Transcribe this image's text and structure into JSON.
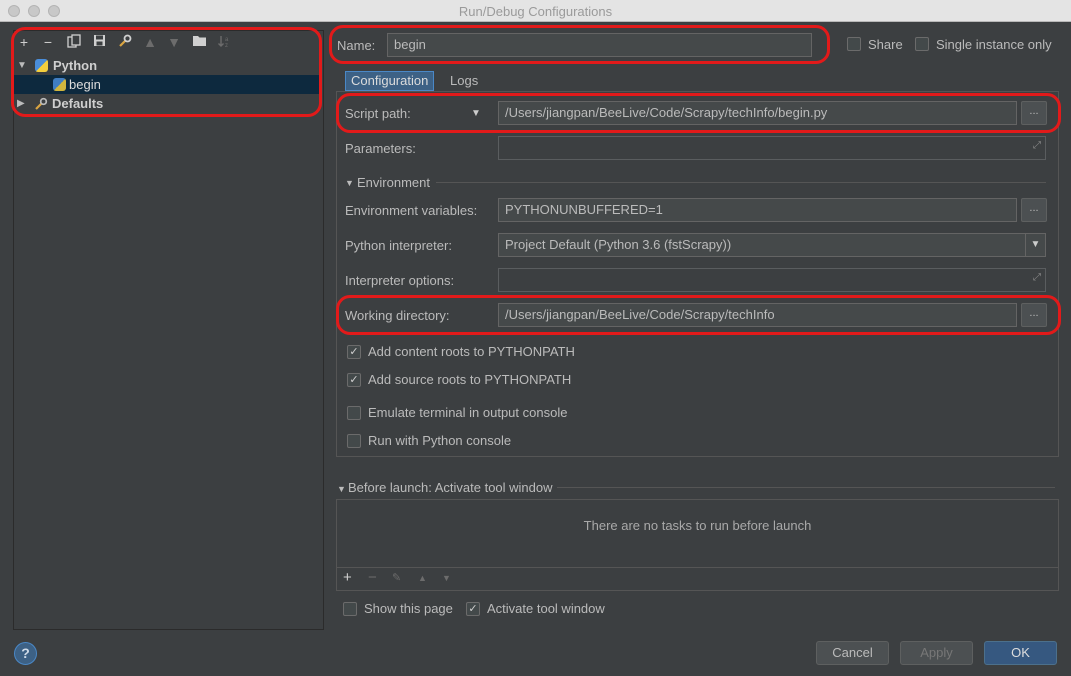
{
  "window": {
    "title": "Run/Debug Configurations"
  },
  "toolbar": {
    "icons": [
      "plus-icon",
      "minus-icon",
      "copy-icon",
      "save-icon",
      "wrench-icon",
      "arrow-up-icon",
      "arrow-down-icon",
      "folder-icon",
      "sort-icon"
    ]
  },
  "tree": {
    "python_label": "Python",
    "begin_label": "begin",
    "defaults_label": "Defaults"
  },
  "header": {
    "name_label": "Name:",
    "name_value": "begin",
    "share_label": "Share",
    "single_instance_label": "Single instance only"
  },
  "tabs": {
    "configuration": "Configuration",
    "logs": "Logs"
  },
  "config": {
    "script_path_label": "Script path:",
    "script_path_value": "/Users/jiangpan/BeeLive/Code/Scrapy/techInfo/begin.py",
    "parameters_label": "Parameters:",
    "environment_section": "Environment",
    "env_vars_label": "Environment variables:",
    "env_vars_value": "PYTHONUNBUFFERED=1",
    "interpreter_label": "Python interpreter:",
    "interpreter_value": "Project Default (Python 3.6 (fstScrapy))",
    "interpreter_options_label": "Interpreter options:",
    "working_dir_label": "Working directory:",
    "working_dir_value": "/Users/jiangpan/BeeLive/Code/Scrapy/techInfo",
    "add_content_roots_label": "Add content roots to PYTHONPATH",
    "add_source_roots_label": "Add source roots to PYTHONPATH",
    "emulate_terminal_label": "Emulate terminal in output console",
    "run_with_console_label": "Run with Python console",
    "dots": "..."
  },
  "before_launch": {
    "title": "Before launch: Activate tool window",
    "empty_text": "There are no tasks to run before launch",
    "show_page_label": "Show this page",
    "activate_window_label": "Activate tool window"
  },
  "buttons": {
    "cancel": "Cancel",
    "apply": "Apply",
    "ok": "OK",
    "help": "?"
  },
  "colors": {
    "accent": "#365880",
    "highlight_ring": "#e21a1a",
    "background": "#3c3f41"
  }
}
